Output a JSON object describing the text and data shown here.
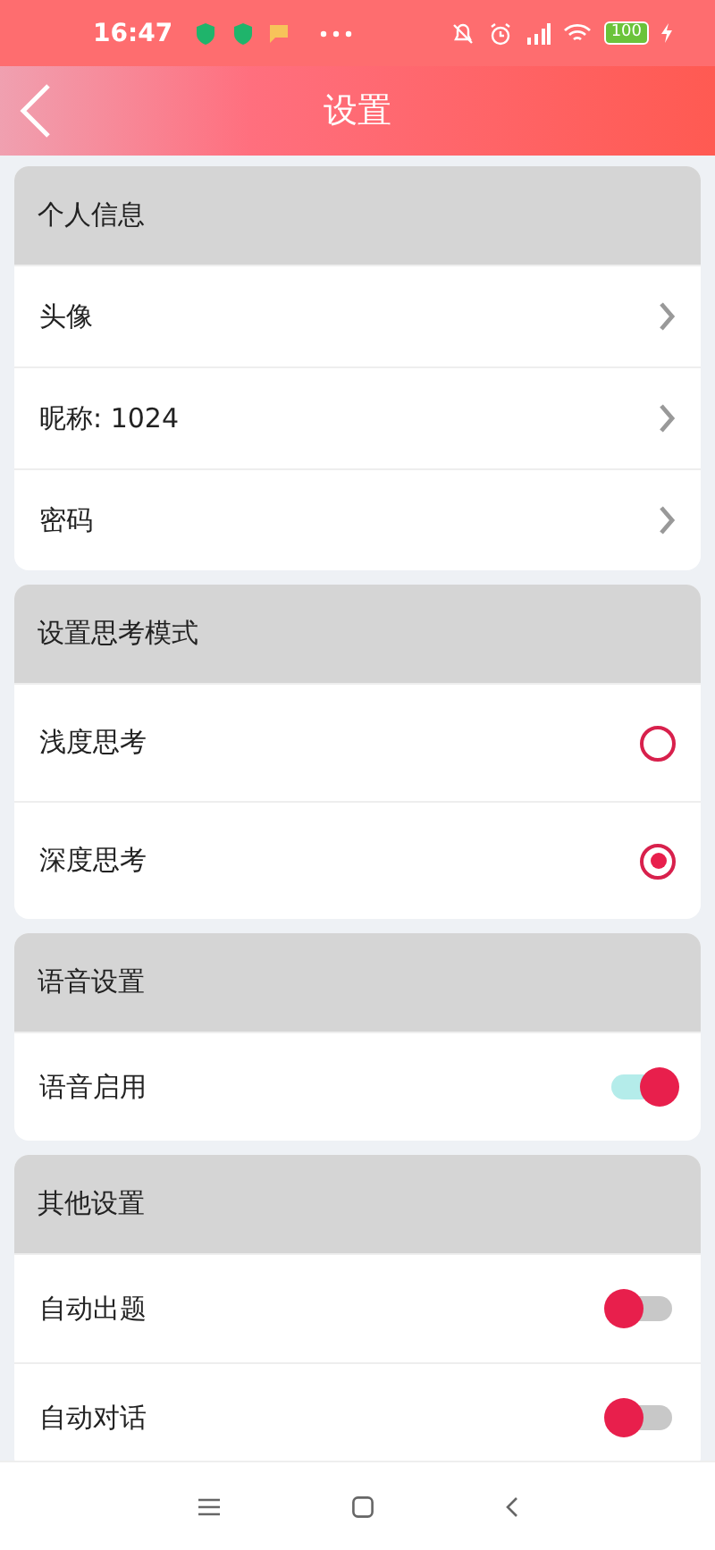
{
  "status_bar": {
    "time": "16:47",
    "battery": "100"
  },
  "header": {
    "title": "设置"
  },
  "sections": [
    {
      "title": "个人信息",
      "rows": [
        {
          "kind": "link",
          "label": "头像"
        },
        {
          "kind": "link",
          "label": "昵称: 1024"
        },
        {
          "kind": "link",
          "label": "密码"
        }
      ]
    },
    {
      "title": "设置思考模式",
      "rows": [
        {
          "kind": "radio",
          "label": "浅度思考",
          "selected": false
        },
        {
          "kind": "radio",
          "label": "深度思考",
          "selected": true
        }
      ]
    },
    {
      "title": "语音设置",
      "rows": [
        {
          "kind": "toggle",
          "label": "语音启用",
          "on": true
        }
      ]
    },
    {
      "title": "其他设置",
      "rows": [
        {
          "kind": "toggle",
          "label": "自动出题",
          "on": false
        },
        {
          "kind": "toggle",
          "label": "自动对话",
          "on": false
        }
      ]
    }
  ]
}
